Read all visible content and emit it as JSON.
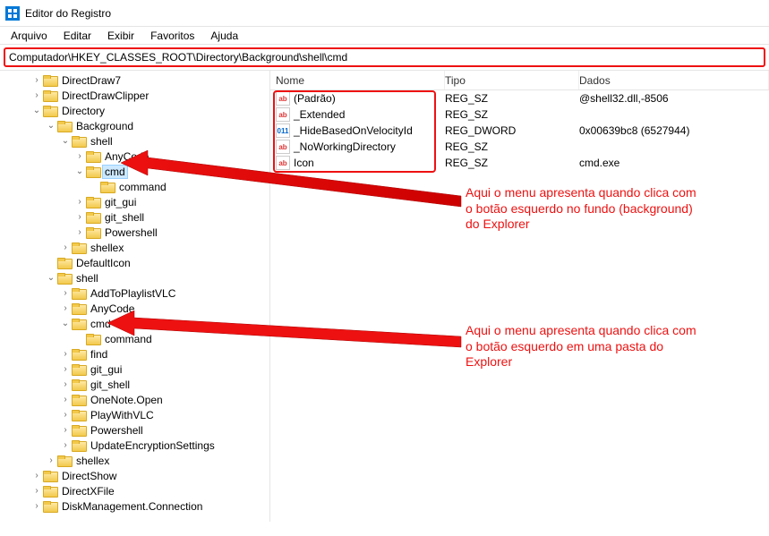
{
  "window": {
    "title": "Editor do Registro"
  },
  "menu": {
    "arquivo": "Arquivo",
    "editar": "Editar",
    "exibir": "Exibir",
    "favoritos": "Favoritos",
    "ajuda": "Ajuda"
  },
  "address": "Computador\\HKEY_CLASSES_ROOT\\Directory\\Background\\shell\\cmd",
  "columns": {
    "name": "Nome",
    "type": "Tipo",
    "data": "Dados"
  },
  "tree": {
    "directdraw7": "DirectDraw7",
    "directdrawclipper": "DirectDrawClipper",
    "directory": "Directory",
    "background": "Background",
    "bg_shell": "shell",
    "anycode": "AnyCode",
    "cmd": "cmd",
    "cmd_command": "command",
    "git_gui": "git_gui",
    "git_shell": "git_shell",
    "powershell": "Powershell",
    "shellex": "shellex",
    "defaulticon": "DefaultIcon",
    "shell": "shell",
    "addtoplaylistvlc": "AddToPlaylistVLC",
    "anycode2": "AnyCode",
    "cmd2": "cmd",
    "cmd2_command": "command",
    "find": "find",
    "git_gui2": "git_gui",
    "git_shell2": "git_shell",
    "onenoteopen": "OneNote.Open",
    "playwithvlc": "PlayWithVLC",
    "powershell2": "Powershell",
    "updateencryptionsettings": "UpdateEncryptionSettings",
    "shellex2": "shellex",
    "directshow": "DirectShow",
    "directxfile": "DirectXFile",
    "diskmgmt": "DiskManagement.Connection"
  },
  "values": [
    {
      "name": "(Padrão)",
      "type": "REG_SZ",
      "data": "@shell32.dll,-8506",
      "iconKind": "str"
    },
    {
      "name": "_Extended",
      "type": "REG_SZ",
      "data": "",
      "iconKind": "str"
    },
    {
      "name": "_HideBasedOnVelocityId",
      "type": "REG_DWORD",
      "data": "0x00639bc8 (6527944)",
      "iconKind": "num"
    },
    {
      "name": "_NoWorkingDirectory",
      "type": "REG_SZ",
      "data": "",
      "iconKind": "str"
    },
    {
      "name": "Icon",
      "type": "REG_SZ",
      "data": "cmd.exe",
      "iconKind": "str"
    }
  ],
  "annotations": {
    "top": "Aqui o menu apresenta quando clica com o botão esquerdo no fundo (background) do Explorer",
    "bottom": "Aqui o menu apresenta quando clica com o botão esquerdo em uma pasta do Explorer"
  }
}
